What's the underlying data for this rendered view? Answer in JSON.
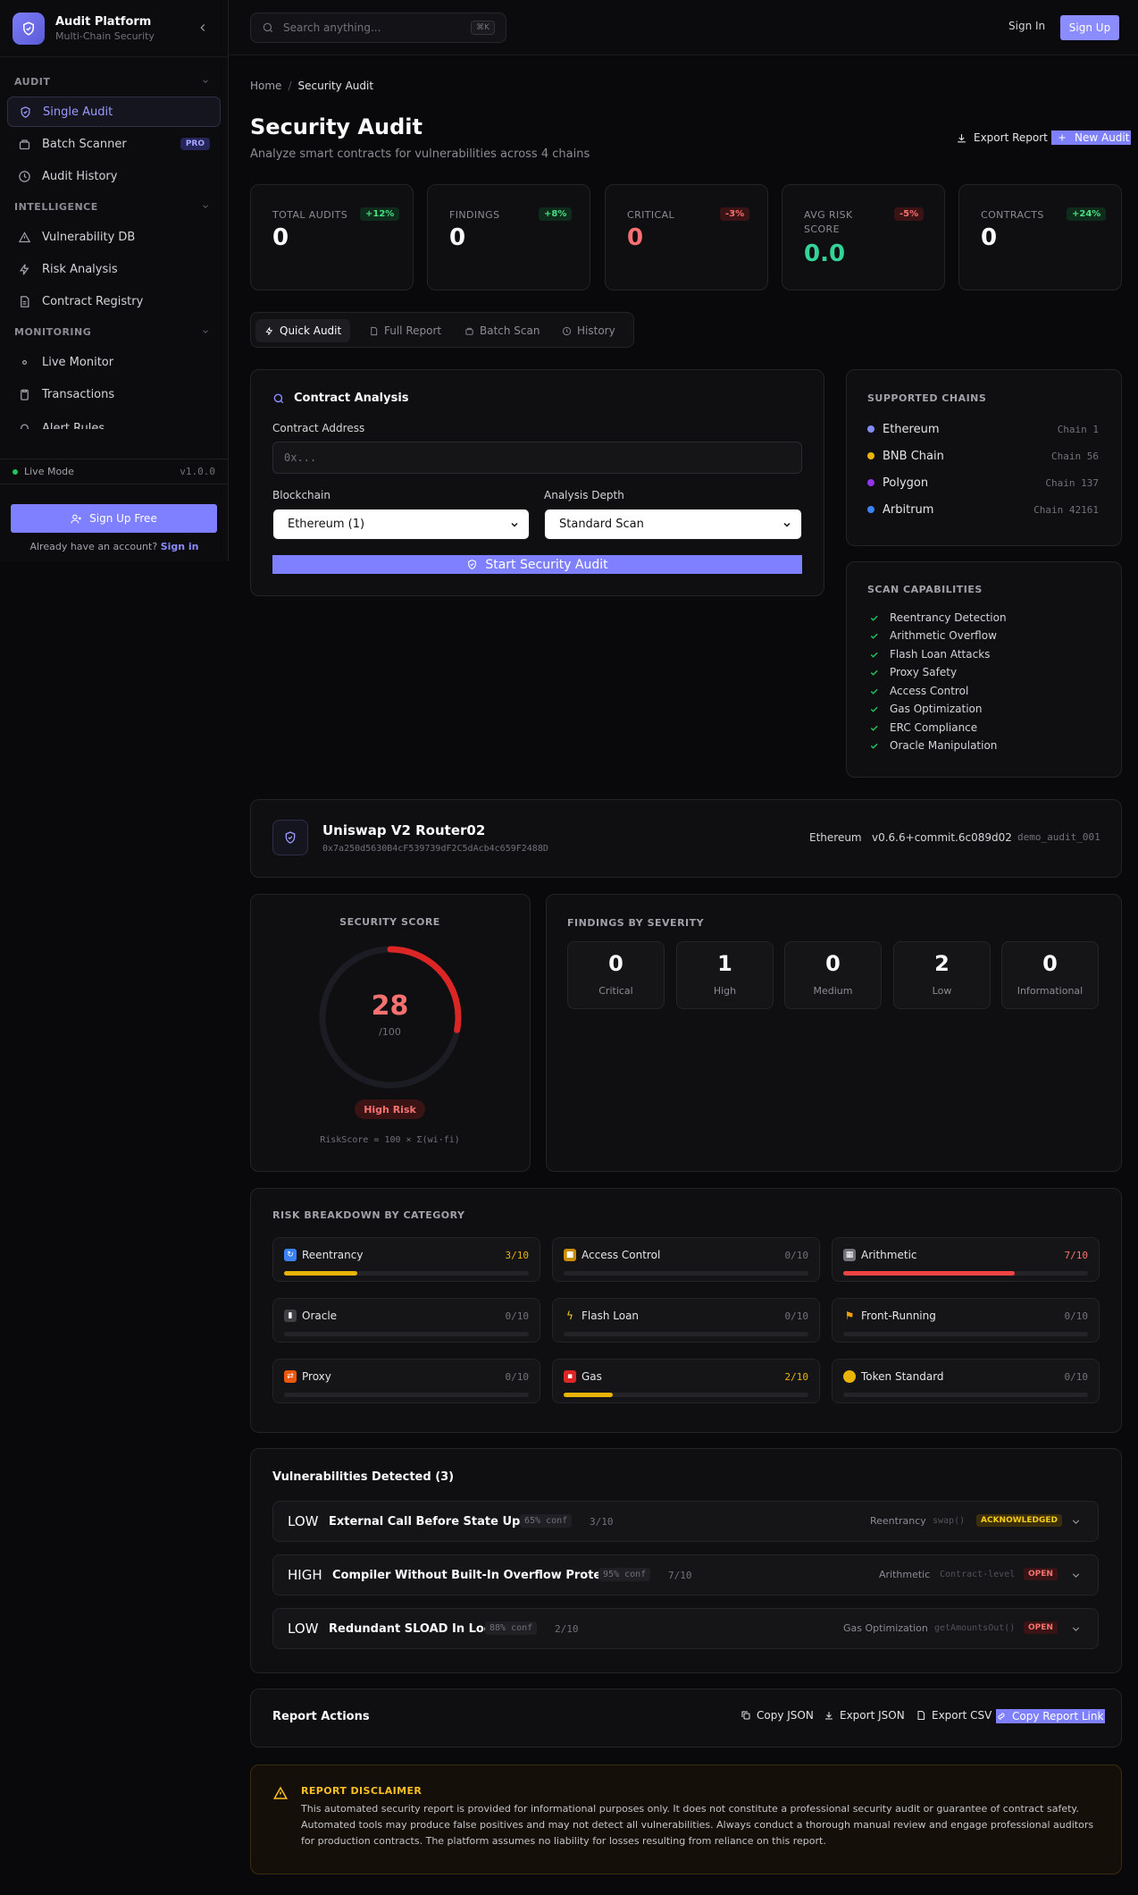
{
  "brand": {
    "title": "Audit Platform",
    "subtitle": "Multi-Chain Security"
  },
  "sidebar": {
    "sections": [
      {
        "title": "AUDIT",
        "items": [
          {
            "label": "Single Audit",
            "icon": "shield-icon",
            "active": true
          },
          {
            "label": "Batch Scanner",
            "icon": "layers-icon",
            "badge": "PRO"
          },
          {
            "label": "Audit History",
            "icon": "clock-icon"
          }
        ]
      },
      {
        "title": "INTELLIGENCE",
        "items": [
          {
            "label": "Vulnerability DB",
            "icon": "warning-icon"
          },
          {
            "label": "Risk Analysis",
            "icon": "bolt-icon"
          },
          {
            "label": "Contract Registry",
            "icon": "document-icon"
          }
        ]
      },
      {
        "title": "MONITORING",
        "items": [
          {
            "label": "Live Monitor",
            "icon": "circle-icon"
          },
          {
            "label": "Transactions",
            "icon": "clipboard-icon"
          },
          {
            "label": "Alert Rules",
            "icon": "bell-icon"
          }
        ]
      }
    ],
    "mode": "Live Mode",
    "version": "v1.0.0",
    "signup_free": "Sign Up Free",
    "already_text": "Already have an account?",
    "signin_link": "Sign in"
  },
  "topbar": {
    "search_placeholder": "Search anything...",
    "shortcut": "⌘K",
    "signin": "Sign In",
    "signup": "Sign Up"
  },
  "breadcrumb": {
    "home": "Home",
    "separator": "/",
    "current": "Security Audit"
  },
  "page": {
    "title": "Security Audit",
    "subtitle": "Analyze smart contracts for vulnerabilities across 4 chains",
    "export_report": "Export Report",
    "new_audit": "New Audit"
  },
  "stats": [
    {
      "label": "TOTAL AUDITS",
      "value": "0",
      "badge": "+12%",
      "trend": "up"
    },
    {
      "label": "FINDINGS",
      "value": "0",
      "badge": "+8%",
      "trend": "up"
    },
    {
      "label": "CRITICAL",
      "value": "0",
      "badge": "-3%",
      "trend": "down"
    },
    {
      "label": "AVG RISK SCORE",
      "value": "0.0",
      "badge": "-5%",
      "trend": "down"
    },
    {
      "label": "CONTRACTS",
      "value": "0",
      "badge": "+24%",
      "trend": "up"
    }
  ],
  "tabs": [
    {
      "label": "Quick Audit",
      "active": true
    },
    {
      "label": "Full Report"
    },
    {
      "label": "Batch Scan"
    },
    {
      "label": "History"
    }
  ],
  "form": {
    "title": "Contract Analysis",
    "address_label": "Contract Address",
    "address_placeholder": "0x...",
    "chain_label": "Blockchain",
    "chain_value": "Ethereum (1)",
    "depth_label": "Analysis Depth",
    "depth_value": "Standard Scan",
    "start": "Start Security Audit"
  },
  "supported_chains": {
    "title": "SUPPORTED CHAINS",
    "items": [
      {
        "name": "Ethereum",
        "id": "Chain 1",
        "color": "#818cf8"
      },
      {
        "name": "BNB Chain",
        "id": "Chain 56",
        "color": "#eab308"
      },
      {
        "name": "Polygon",
        "id": "Chain 137",
        "color": "#9333ea"
      },
      {
        "name": "Arbitrum",
        "id": "Chain 42161",
        "color": "#3b82f6"
      }
    ]
  },
  "capabilities": {
    "title": "SCAN CAPABILITIES",
    "items": [
      "Reentrancy Detection",
      "Arithmetic Overflow",
      "Flash Loan Attacks",
      "Proxy Safety",
      "Access Control",
      "Gas Optimization",
      "ERC Compliance",
      "Oracle Manipulation"
    ]
  },
  "contract": {
    "name": "Uniswap V2 Router02",
    "address": "0x7a250d5630B4cF539739dF2C5dAcb4c659F2488D",
    "chain": "Ethereum",
    "compiler": "v0.6.6+commit.6c089d02",
    "audit_id": "demo_audit_001"
  },
  "score": {
    "title": "SECURITY SCORE",
    "value": 28,
    "max": "/100",
    "label": "High Risk",
    "formula": "RiskScore = 100 × Σ(wi·fi)"
  },
  "severity": {
    "title": "FINDINGS BY SEVERITY",
    "items": [
      {
        "count": "0",
        "label": "Critical"
      },
      {
        "count": "1",
        "label": "High"
      },
      {
        "count": "0",
        "label": "Medium"
      },
      {
        "count": "2",
        "label": "Low"
      },
      {
        "count": "0",
        "label": "Informational"
      }
    ]
  },
  "risk_breakdown": {
    "title": "RISK BREAKDOWN BY CATEGORY",
    "items": [
      {
        "name": "Reentrancy",
        "score": "3/10",
        "value": 3,
        "icon": "refresh-icon",
        "color": "#eab308"
      },
      {
        "name": "Access Control",
        "score": "0/10",
        "value": 0,
        "icon": "lock-icon",
        "color": "#eab308"
      },
      {
        "name": "Arithmetic",
        "score": "7/10",
        "value": 7,
        "icon": "calculator-icon",
        "color": "#ef4444"
      },
      {
        "name": "Oracle",
        "score": "0/10",
        "value": 0,
        "icon": "chart-icon",
        "color": "#eab308"
      },
      {
        "name": "Flash Loan",
        "score": "0/10",
        "value": 0,
        "icon": "bolt-icon",
        "color": "#eab308"
      },
      {
        "name": "Front-Running",
        "score": "0/10",
        "value": 0,
        "icon": "runner-icon",
        "color": "#eab308"
      },
      {
        "name": "Proxy",
        "score": "0/10",
        "value": 0,
        "icon": "shuffle-icon",
        "color": "#eab308"
      },
      {
        "name": "Gas",
        "score": "2/10",
        "value": 2,
        "icon": "fuel-icon",
        "color": "#eab308"
      },
      {
        "name": "Token Standard",
        "score": "0/10",
        "value": 0,
        "icon": "coin-icon",
        "color": "#eab308"
      }
    ]
  },
  "vulnerabilities": {
    "title": "Vulnerabilities Detected (3)",
    "items": [
      {
        "severity": "LOW",
        "title": "External Call Before State Update",
        "confidence": "65% conf",
        "score": "3/10",
        "category": "Reentrancy",
        "function": "swap()",
        "status": "ACKNOWLEDGED"
      },
      {
        "severity": "HIGH",
        "title": "Compiler Without Built-In Overflow Protection",
        "confidence": "95% conf",
        "score": "7/10",
        "category": "Arithmetic",
        "function": "Contract-level",
        "status": "OPEN"
      },
      {
        "severity": "LOW",
        "title": "Redundant SLOAD In Loop",
        "confidence": "88% conf",
        "score": "2/10",
        "category": "Gas Optimization",
        "function": "getAmountsOut()",
        "status": "OPEN"
      }
    ]
  },
  "report_actions": {
    "title": "Report Actions",
    "copy_json": "Copy JSON",
    "export_json": "Export JSON",
    "export_csv": "Export CSV",
    "copy_link": "Copy Report Link"
  },
  "disclaimer": {
    "title": "REPORT DISCLAIMER",
    "text": "This automated security report is provided for informational purposes only. It does not constitute a professional security audit or guarantee of contract safety. Automated tools may produce false positives and may not detect all vulnerabilities. Always conduct a thorough manual review and engage professional auditors for production contracts. The platform assumes no liability for losses resulting from reliance on this report."
  }
}
